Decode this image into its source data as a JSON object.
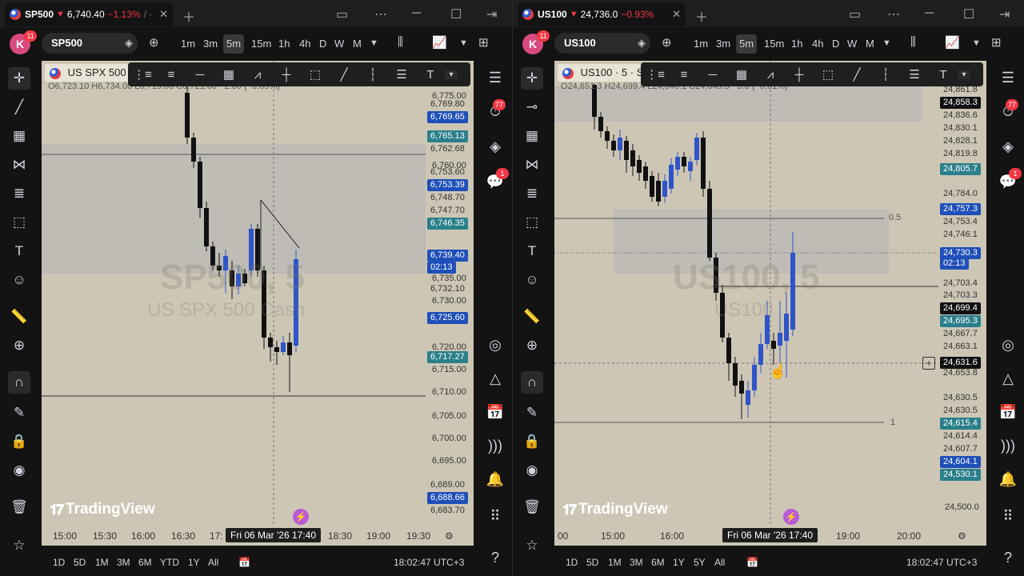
{
  "left": {
    "tab": {
      "symbol": "SP500",
      "arrow": "▼",
      "price": "6,740.40",
      "change": "−1.13%",
      "tail": "/ ·"
    },
    "toolbar": {
      "avatar": "K",
      "avatar_badge": "11",
      "symbol": "SP500",
      "timeframes": [
        "1m",
        "3m",
        "5m",
        "15m",
        "1h",
        "4h",
        "D",
        "W",
        "M"
      ],
      "active_tf": "5m"
    },
    "legend": {
      "title": "US SPX 500",
      "ohlc": "O6,723.10 H6,734.00 L6,719.00 C6,721.60 −2.00 (−0.03%)"
    },
    "watermark": {
      "main": "SP500, 5",
      "sub": "US SPX 500 Cash"
    },
    "logo": "TradingView",
    "price_ticks": [
      "6,775.00",
      "6,760.00",
      "6,735.00",
      "6,730.00",
      "6,720.00",
      "6,715.00",
      "6,710.00",
      "6,705.00",
      "6,700.00",
      "6,695.00"
    ],
    "price_labels": [
      {
        "text": "6,769.80",
        "style": "plain"
      },
      {
        "text": "6,769.65",
        "style": "blue"
      },
      {
        "text": "6,765.13",
        "style": "teal"
      },
      {
        "text": "6,762.68",
        "style": "plain"
      },
      {
        "text": "6,753.60",
        "style": "plain"
      },
      {
        "text": "6,753.39",
        "style": "blue"
      },
      {
        "text": "6,748.70",
        "style": "plain"
      },
      {
        "text": "6,747.70",
        "style": "plain"
      },
      {
        "text": "6,746.35",
        "style": "teal"
      },
      {
        "text": "6,739.40",
        "style": "blue"
      },
      {
        "text": "6,732.10",
        "style": "plain"
      },
      {
        "text": "6,725.60",
        "style": "blue"
      },
      {
        "text": "6,717.27",
        "style": "teal"
      },
      {
        "text": "6,689.00",
        "style": "plain"
      },
      {
        "text": "6,688.66",
        "style": "blue"
      },
      {
        "text": "6,683.70",
        "style": "plain"
      }
    ],
    "countdown": "02:13",
    "time_labels": [
      "15:00",
      "15:30",
      "16:00",
      "16:30",
      "17:",
      "18:30",
      "19:00",
      "19:30"
    ],
    "current_time": "Fri 06 Mar '26   17:40",
    "ranges": [
      "1D",
      "5D",
      "1M",
      "3M",
      "6M",
      "YTD",
      "1Y",
      "All"
    ],
    "clock": "18:02:47 UTC+3",
    "alerts_badge": "77",
    "chat_badge": "1"
  },
  "right": {
    "tab": {
      "symbol": "US100",
      "arrow": "▼",
      "price": "24,736.0",
      "change": "−0.93%",
      "tail": ""
    },
    "toolbar": {
      "avatar": "K",
      "avatar_badge": "11",
      "symbol": "US100",
      "timeframes": [
        "1m",
        "3m",
        "5m",
        "15m",
        "1h",
        "4h",
        "D",
        "W",
        "M"
      ],
      "active_tf": "5m"
    },
    "legend": {
      "title": "US100 · 5 · S",
      "ohlc": "O24,651.3 H24,699.4 L24,646.1 C24,649.3 −3.0 (−0.01%)"
    },
    "watermark": {
      "main": "US100, 5",
      "sub": "US100"
    },
    "logo": "TradingView",
    "fib": [
      "0.5",
      "1"
    ],
    "price_labels": [
      {
        "text": "24,861.8",
        "style": "plain"
      },
      {
        "text": "24,858.3",
        "style": "dark"
      },
      {
        "text": "24,836.6",
        "style": "plain"
      },
      {
        "text": "24,830.1",
        "style": "plain"
      },
      {
        "text": "24,828.1",
        "style": "plain"
      },
      {
        "text": "24,819.8",
        "style": "plain"
      },
      {
        "text": "24,805.7",
        "style": "teal"
      },
      {
        "text": "24,784.0",
        "style": "plain"
      },
      {
        "text": "24,757.3",
        "style": "blue"
      },
      {
        "text": "24,753.4",
        "style": "plain"
      },
      {
        "text": "24,746.1",
        "style": "plain"
      },
      {
        "text": "24,730.3",
        "style": "blue"
      },
      {
        "text": "24,703.4",
        "style": "plain"
      },
      {
        "text": "24,703.3",
        "style": "plain"
      },
      {
        "text": "24,699.4",
        "style": "dark"
      },
      {
        "text": "24,695.3",
        "style": "teal"
      },
      {
        "text": "24,667.7",
        "style": "plain"
      },
      {
        "text": "24,663.1",
        "style": "plain"
      },
      {
        "text": "24,631.6",
        "style": "dark"
      },
      {
        "text": "24,653.8",
        "style": "plain"
      },
      {
        "text": "24,630.5",
        "style": "plain"
      },
      {
        "text": "24,630.5",
        "style": "plain"
      },
      {
        "text": "24,615.4",
        "style": "teal"
      },
      {
        "text": "24,614.4",
        "style": "plain"
      },
      {
        "text": "24,607.7",
        "style": "plain"
      },
      {
        "text": "24,604.1",
        "style": "blue"
      },
      {
        "text": "24,530.1",
        "style": "teal"
      }
    ],
    "bottom_tick": "24,500.0",
    "countdown": "02:13",
    "time_labels": [
      "00",
      "15:00",
      "16:00",
      "19:00",
      "20:00"
    ],
    "current_time": "Fri 06 Mar '26   17:40",
    "ranges": [
      "1D",
      "5D",
      "1M",
      "3M",
      "6M",
      "1Y",
      "5Y",
      "All"
    ],
    "clock": "18:02:47 UTC+3",
    "alerts_badge": "77",
    "chat_badge": "1"
  }
}
